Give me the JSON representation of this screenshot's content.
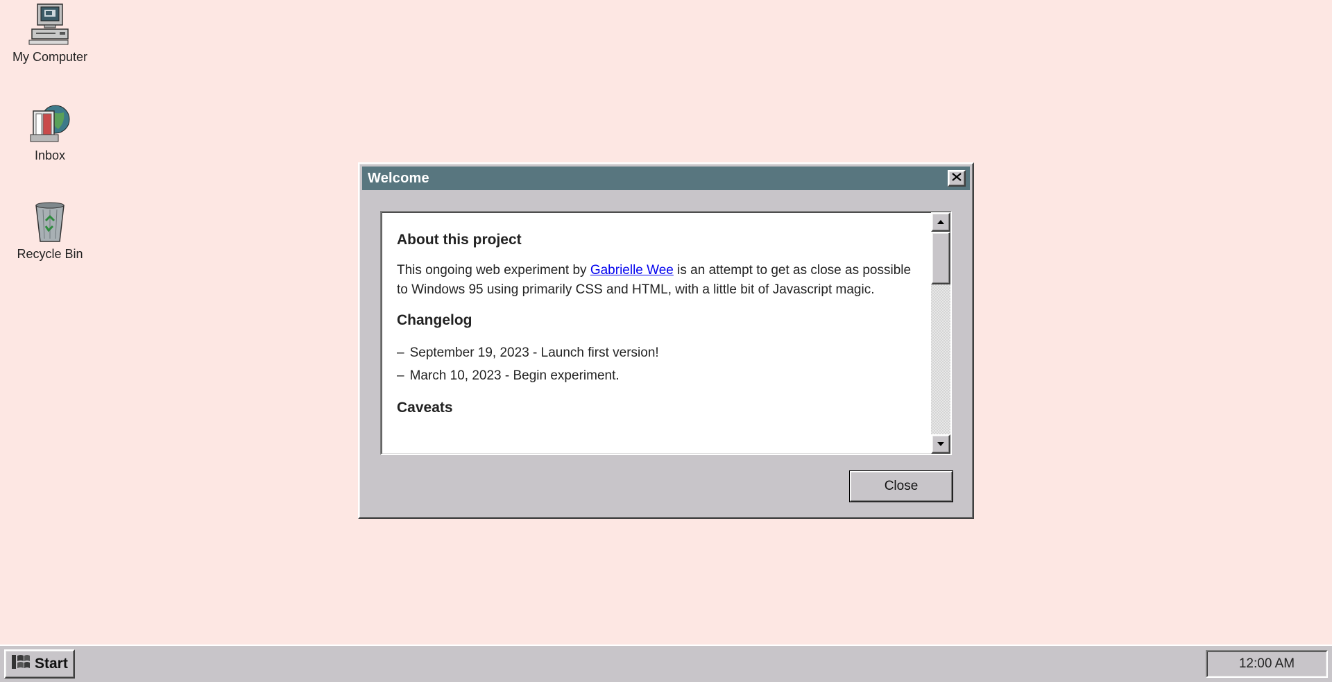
{
  "desktop": {
    "icons": [
      {
        "label": "My Computer",
        "icon": "computer-icon"
      },
      {
        "label": "Inbox",
        "icon": "inbox-icon"
      },
      {
        "label": "Recycle Bin",
        "icon": "recycle-bin-icon"
      }
    ]
  },
  "dialog": {
    "title": "Welcome",
    "close_icon": "close-icon",
    "sections": {
      "about_heading": "About this project",
      "about_text_before": "This ongoing web experiment by ",
      "about_link": "Gabrielle Wee",
      "about_text_after": " is an attempt to get as close as possible to Windows 95 using primarily CSS and HTML, with a little bit of Javascript magic.",
      "changelog_heading": "Changelog",
      "changelog_items": [
        "September 19, 2023 - Launch first version!",
        "March 10, 2023 - Begin experiment."
      ],
      "caveats_heading": "Caveats"
    },
    "close_button_label": "Close"
  },
  "taskbar": {
    "start_label": "Start",
    "clock": "12:00 AM"
  },
  "colors": {
    "desktop": "#fde7e3",
    "titlebar": "#58767f",
    "chrome": "#c8c5c9",
    "link": "#0000ee"
  }
}
